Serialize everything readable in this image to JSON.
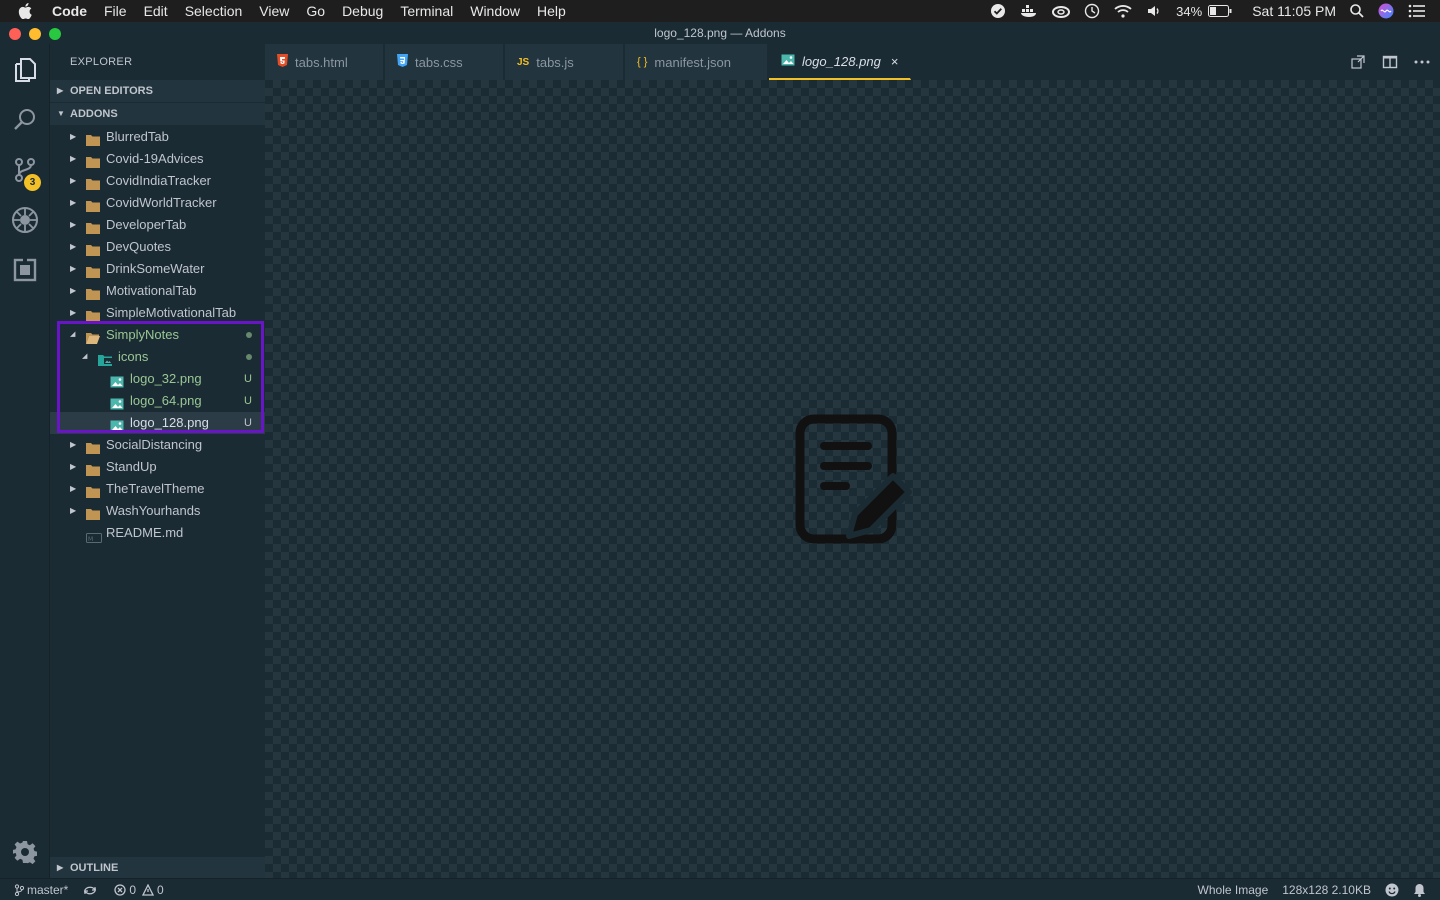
{
  "menubar": {
    "items": [
      "Code",
      "File",
      "Edit",
      "Selection",
      "View",
      "Go",
      "Debug",
      "Terminal",
      "Window",
      "Help"
    ],
    "battery": "34%",
    "clock": "Sat 11:05 PM"
  },
  "window": {
    "title": "logo_128.png — Addons"
  },
  "activity": {
    "scm_badge": "3"
  },
  "sidebar": {
    "title": "EXPLORER",
    "open_editors": "OPEN EDITORS",
    "root": "ADDONS",
    "outline": "OUTLINE",
    "tree": [
      {
        "label": "BlurredTab"
      },
      {
        "label": "Covid-19Advices"
      },
      {
        "label": "CovidIndiaTracker"
      },
      {
        "label": "CovidWorldTracker"
      },
      {
        "label": "DeveloperTab"
      },
      {
        "label": "DevQuotes"
      },
      {
        "label": "DrinkSomeWater"
      },
      {
        "label": "MotivationalTab"
      },
      {
        "label": "SimpleMotivationalTab"
      },
      {
        "label": "SimplyNotes"
      },
      {
        "label": "icons"
      },
      {
        "label": "logo_32.png",
        "deco": "U"
      },
      {
        "label": "logo_64.png",
        "deco": "U"
      },
      {
        "label": "logo_128.png",
        "deco": "U"
      },
      {
        "label": "SocialDistancing"
      },
      {
        "label": "StandUp"
      },
      {
        "label": "TheTravelTheme"
      },
      {
        "label": "WashYourhands"
      },
      {
        "label": "README.md"
      }
    ]
  },
  "tabs": [
    {
      "label": "tabs.html",
      "icon_text": "5",
      "color": "#e44d26"
    },
    {
      "label": "tabs.css",
      "icon_text": "3",
      "color": "#42a5f5"
    },
    {
      "label": "tabs.js",
      "icon_text": "JS",
      "color": "#f2c027"
    },
    {
      "label": "manifest.json",
      "icon_text": "{ }",
      "color": "#f2c027"
    },
    {
      "label": "logo_128.png",
      "icon_text": "",
      "color": "#4db6ac",
      "active": true
    }
  ],
  "tab_close": "×",
  "statusbar": {
    "branch": "master*",
    "errors": "0",
    "warnings": "0",
    "image_scope": "Whole Image",
    "image_info": "128x128 2.10KB"
  },
  "colors": {
    "accent": "#f2c027",
    "git_untracked": "#99c794",
    "highlight_box": "#6a14c8"
  }
}
